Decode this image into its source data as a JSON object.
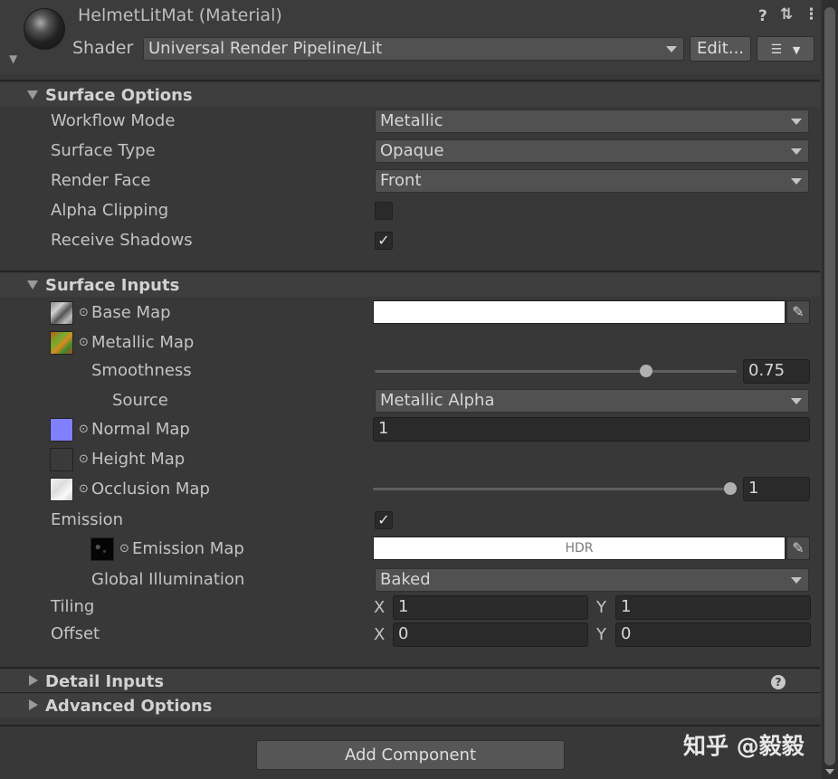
{
  "header": {
    "title": "HelmetLitMat (Material)",
    "shader_label": "Shader",
    "shader_value": "Universal Render Pipeline/Lit",
    "edit_button": "Edit...",
    "icons": [
      "help-icon",
      "preset-icon",
      "kebab-menu-icon",
      "list-icon"
    ]
  },
  "surface_options": {
    "title": "Surface Options",
    "workflow_mode": {
      "label": "Workflow Mode",
      "value": "Metallic"
    },
    "surface_type": {
      "label": "Surface Type",
      "value": "Opaque"
    },
    "render_face": {
      "label": "Render Face",
      "value": "Front"
    },
    "alpha_clipping": {
      "label": "Alpha Clipping",
      "checked": false
    },
    "receive_shadows": {
      "label": "Receive Shadows",
      "checked": true,
      "check": "✓"
    }
  },
  "surface_inputs": {
    "title": "Surface Inputs",
    "base_map": {
      "label": "Base Map"
    },
    "metallic_map": {
      "label": "Metallic Map"
    },
    "smoothness": {
      "label": "Smoothness",
      "value": "0.75",
      "fraction": 0.75
    },
    "source": {
      "label": "Source",
      "value": "Metallic Alpha"
    },
    "normal_map": {
      "label": "Normal Map",
      "value": "1"
    },
    "height_map": {
      "label": "Height Map"
    },
    "occlusion_map": {
      "label": "Occlusion Map",
      "value": "1",
      "fraction": 1.0
    },
    "emission": {
      "label": "Emission",
      "checked": true,
      "check": "✓"
    },
    "emission_map": {
      "label": "Emission Map",
      "hdr": "HDR"
    },
    "global_illumination": {
      "label": "Global Illumination",
      "value": "Baked"
    },
    "tiling": {
      "label": "Tiling",
      "x_label": "X",
      "x": "1",
      "y_label": "Y",
      "y": "1"
    },
    "offset": {
      "label": "Offset",
      "x_label": "X",
      "x": "0",
      "y_label": "Y",
      "y": "0"
    }
  },
  "detail_inputs": {
    "title": "Detail Inputs"
  },
  "advanced_options": {
    "title": "Advanced Options"
  },
  "footer": {
    "add_component": "Add Component",
    "watermark": "知乎 @毅毅"
  },
  "colors": {
    "background": "#383838",
    "field": "#2a2a2a",
    "dropdown": "#515151",
    "normal_map_swatch": "#8080ff"
  }
}
